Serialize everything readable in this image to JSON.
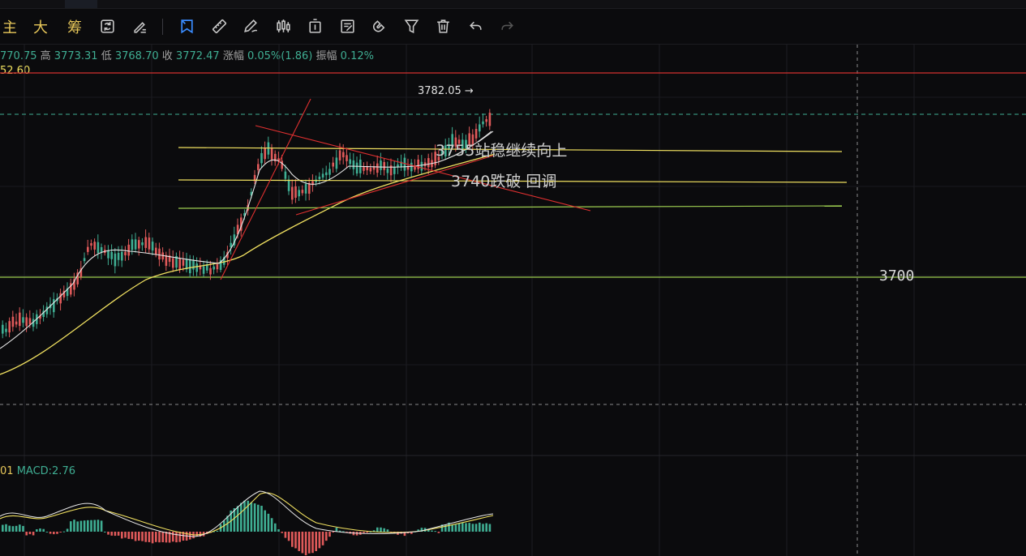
{
  "toolbar": {
    "text_tools": [
      "主",
      "大",
      "筹"
    ],
    "icons": [
      "cycle-icon",
      "brush-list-icon",
      "bookmark-icon",
      "ruler-icon",
      "pen-icon",
      "candlestick-icon",
      "delete-single-icon",
      "note-icon",
      "magnet-icon",
      "filter-icon",
      "trash-icon",
      "undo-icon",
      "redo-icon"
    ]
  },
  "ohlc": {
    "open_value": "770.75",
    "high_label": "高",
    "high_value": "3773.31",
    "low_label": "低",
    "low_value": "3768.70",
    "close_label": "收",
    "close_value": "3772.47",
    "change_label": "涨幅",
    "change_value": "0.05%(1.86)",
    "amp_label": "振幅",
    "amp_value": "0.12%"
  },
  "ref_line_label": "52.60",
  "high_marker": "3782.05",
  "annotations": {
    "upper": "3755站稳继续向上",
    "lower": "3740跌破  回调",
    "level": "3700"
  },
  "macd": {
    "prefix": "01",
    "label": "MACD:2.76"
  },
  "colors": {
    "up": "#3fae93",
    "down": "#e05a5a",
    "accent_blue": "#3a8cff",
    "yellow_line": "#f0e060",
    "green_line": "#9ccc50",
    "red_line": "#e03030"
  }
}
